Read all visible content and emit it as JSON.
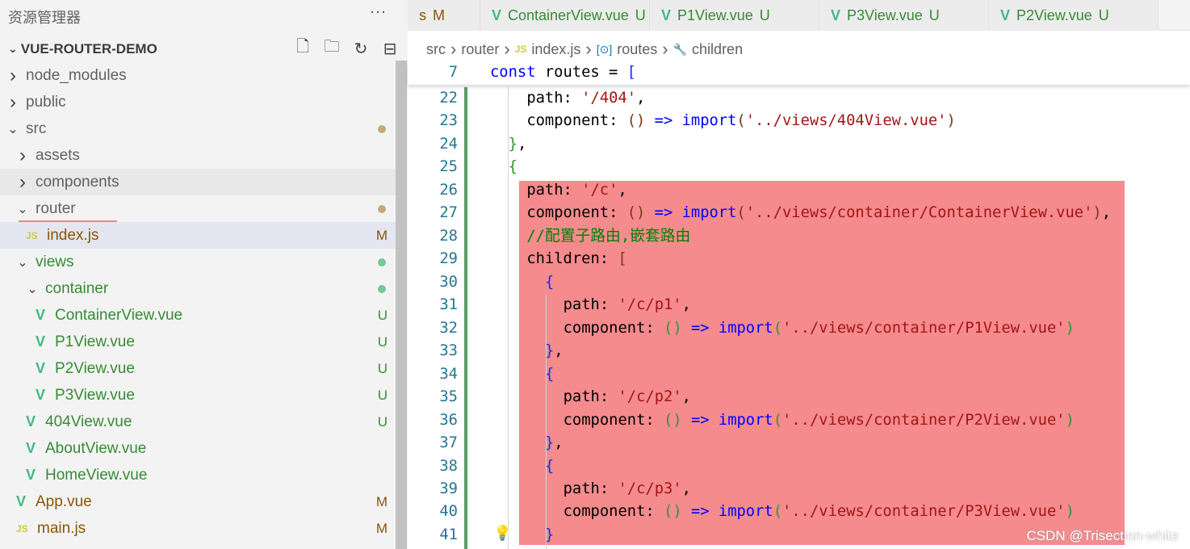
{
  "sidebar": {
    "title": "资源管理器",
    "more": "···",
    "project": "VUE-ROUTER-DEMO",
    "tree": [
      {
        "name": "node_modules",
        "type": "folder",
        "depth": 0
      },
      {
        "name": "public",
        "type": "folder",
        "depth": 0
      },
      {
        "name": "src",
        "type": "folder-open",
        "depth": 0,
        "dot": "#c5a97d"
      },
      {
        "name": "assets",
        "type": "folder",
        "depth": 1
      },
      {
        "name": "components",
        "type": "folder",
        "depth": 1,
        "hover": true
      },
      {
        "name": "router",
        "type": "folder-open",
        "depth": 1,
        "dot": "#c5a97d"
      },
      {
        "name": "index.js",
        "type": "js",
        "depth": 2,
        "status": "M",
        "selected": true
      },
      {
        "name": "views",
        "type": "folder-open",
        "depth": 1,
        "dot": "#73c991"
      },
      {
        "name": "container",
        "type": "folder-open",
        "depth": 2,
        "dot": "#73c991"
      },
      {
        "name": "ContainerView.vue",
        "type": "vue",
        "depth": 3,
        "status": "U"
      },
      {
        "name": "P1View.vue",
        "type": "vue",
        "depth": 3,
        "status": "U"
      },
      {
        "name": "P2View.vue",
        "type": "vue",
        "depth": 3,
        "status": "U"
      },
      {
        "name": "P3View.vue",
        "type": "vue",
        "depth": 3,
        "status": "U"
      },
      {
        "name": "404View.vue",
        "type": "vue",
        "depth": 2,
        "status": "U"
      },
      {
        "name": "AboutView.vue",
        "type": "vue",
        "depth": 2
      },
      {
        "name": "HomeView.vue",
        "type": "vue",
        "depth": 2
      },
      {
        "name": "App.vue",
        "type": "vue",
        "depth": 1,
        "status": "M"
      },
      {
        "name": "main.js",
        "type": "js",
        "depth": 1,
        "status": "M"
      }
    ]
  },
  "tabs": [
    {
      "label": "s",
      "status": "M",
      "partial": true
    },
    {
      "label": "ContainerView.vue",
      "status": "U"
    },
    {
      "label": "P1View.vue",
      "status": "U"
    },
    {
      "label": "P3View.vue",
      "status": "U"
    },
    {
      "label": "P2View.vue",
      "status": "U"
    }
  ],
  "breadcrumb": [
    "src",
    "router",
    "index.js",
    "routes",
    "children"
  ],
  "sticky": {
    "n": 7,
    "tokens": [
      [
        "kw",
        "const"
      ],
      [
        "p",
        " routes = "
      ],
      [
        "b1",
        "["
      ]
    ]
  },
  "code": [
    {
      "n": 22,
      "i": 4,
      "t": [
        [
          "p",
          "path: "
        ],
        [
          "str",
          "'/404'"
        ],
        [
          "p",
          ","
        ]
      ]
    },
    {
      "n": 23,
      "i": 4,
      "t": [
        [
          "p",
          "component: "
        ],
        [
          "b3",
          "()"
        ],
        [
          "p",
          " "
        ],
        [
          "fn",
          "=>"
        ],
        [
          "p",
          " "
        ],
        [
          "kw",
          "import"
        ],
        [
          "b3",
          "("
        ],
        [
          "str",
          "'../views/404View.vue'"
        ],
        [
          "b3",
          ")"
        ]
      ]
    },
    {
      "n": 24,
      "i": 2,
      "t": [
        [
          "b2",
          "}"
        ],
        [
          "p",
          ","
        ]
      ]
    },
    {
      "n": 25,
      "i": 2,
      "t": [
        [
          "b2",
          "{"
        ]
      ]
    },
    {
      "n": 26,
      "i": 4,
      "t": [
        [
          "p",
          "path: "
        ],
        [
          "str",
          "'/c'"
        ],
        [
          "p",
          ","
        ]
      ]
    },
    {
      "n": 27,
      "i": 4,
      "t": [
        [
          "p",
          "component: "
        ],
        [
          "b3",
          "()"
        ],
        [
          "p",
          " "
        ],
        [
          "fn",
          "=>"
        ],
        [
          "p",
          " "
        ],
        [
          "kw",
          "import"
        ],
        [
          "b3",
          "("
        ],
        [
          "str",
          "'../views/container/ContainerView.vue'"
        ],
        [
          "b3",
          ")"
        ],
        [
          "p",
          ","
        ]
      ]
    },
    {
      "n": 28,
      "i": 4,
      "t": [
        [
          "cm",
          "//配置子路由,嵌套路由"
        ]
      ]
    },
    {
      "n": 29,
      "i": 4,
      "t": [
        [
          "p",
          "children: "
        ],
        [
          "b3",
          "["
        ]
      ]
    },
    {
      "n": 30,
      "i": 6,
      "t": [
        [
          "b1",
          "{"
        ]
      ]
    },
    {
      "n": 31,
      "i": 8,
      "t": [
        [
          "p",
          "path: "
        ],
        [
          "str",
          "'/c/p1'"
        ],
        [
          "p",
          ","
        ]
      ]
    },
    {
      "n": 32,
      "i": 8,
      "t": [
        [
          "p",
          "component: "
        ],
        [
          "b2",
          "()"
        ],
        [
          "p",
          " "
        ],
        [
          "fn",
          "=>"
        ],
        [
          "p",
          " "
        ],
        [
          "kw",
          "import"
        ],
        [
          "b2",
          "("
        ],
        [
          "str",
          "'../views/container/P1View.vue'"
        ],
        [
          "b2",
          ")"
        ]
      ]
    },
    {
      "n": 33,
      "i": 6,
      "t": [
        [
          "b1",
          "}"
        ],
        [
          "p",
          ","
        ]
      ]
    },
    {
      "n": 34,
      "i": 6,
      "t": [
        [
          "b1",
          "{"
        ]
      ]
    },
    {
      "n": 35,
      "i": 8,
      "t": [
        [
          "p",
          "path: "
        ],
        [
          "str",
          "'/c/p2'"
        ],
        [
          "p",
          ","
        ]
      ]
    },
    {
      "n": 36,
      "i": 8,
      "t": [
        [
          "p",
          "component: "
        ],
        [
          "b2",
          "()"
        ],
        [
          "p",
          " "
        ],
        [
          "fn",
          "=>"
        ],
        [
          "p",
          " "
        ],
        [
          "kw",
          "import"
        ],
        [
          "b2",
          "("
        ],
        [
          "str",
          "'../views/container/P2View.vue'"
        ],
        [
          "b2",
          ")"
        ]
      ]
    },
    {
      "n": 37,
      "i": 6,
      "t": [
        [
          "b1",
          "}"
        ],
        [
          "p",
          ","
        ]
      ]
    },
    {
      "n": 38,
      "i": 6,
      "t": [
        [
          "b1",
          "{"
        ]
      ]
    },
    {
      "n": 39,
      "i": 8,
      "t": [
        [
          "p",
          "path: "
        ],
        [
          "str",
          "'/c/p3'"
        ],
        [
          "p",
          ","
        ]
      ]
    },
    {
      "n": 40,
      "i": 8,
      "t": [
        [
          "p",
          "component: "
        ],
        [
          "b2",
          "()"
        ],
        [
          "p",
          " "
        ],
        [
          "fn",
          "=>"
        ],
        [
          "p",
          " "
        ],
        [
          "kw",
          "import"
        ],
        [
          "b2",
          "("
        ],
        [
          "str",
          "'../views/container/P3View.vue'"
        ],
        [
          "b2",
          ")"
        ]
      ]
    },
    {
      "n": 41,
      "i": 6,
      "t": [
        [
          "b1",
          "}"
        ]
      ]
    }
  ],
  "watermark": "CSDN @Trisection-white"
}
